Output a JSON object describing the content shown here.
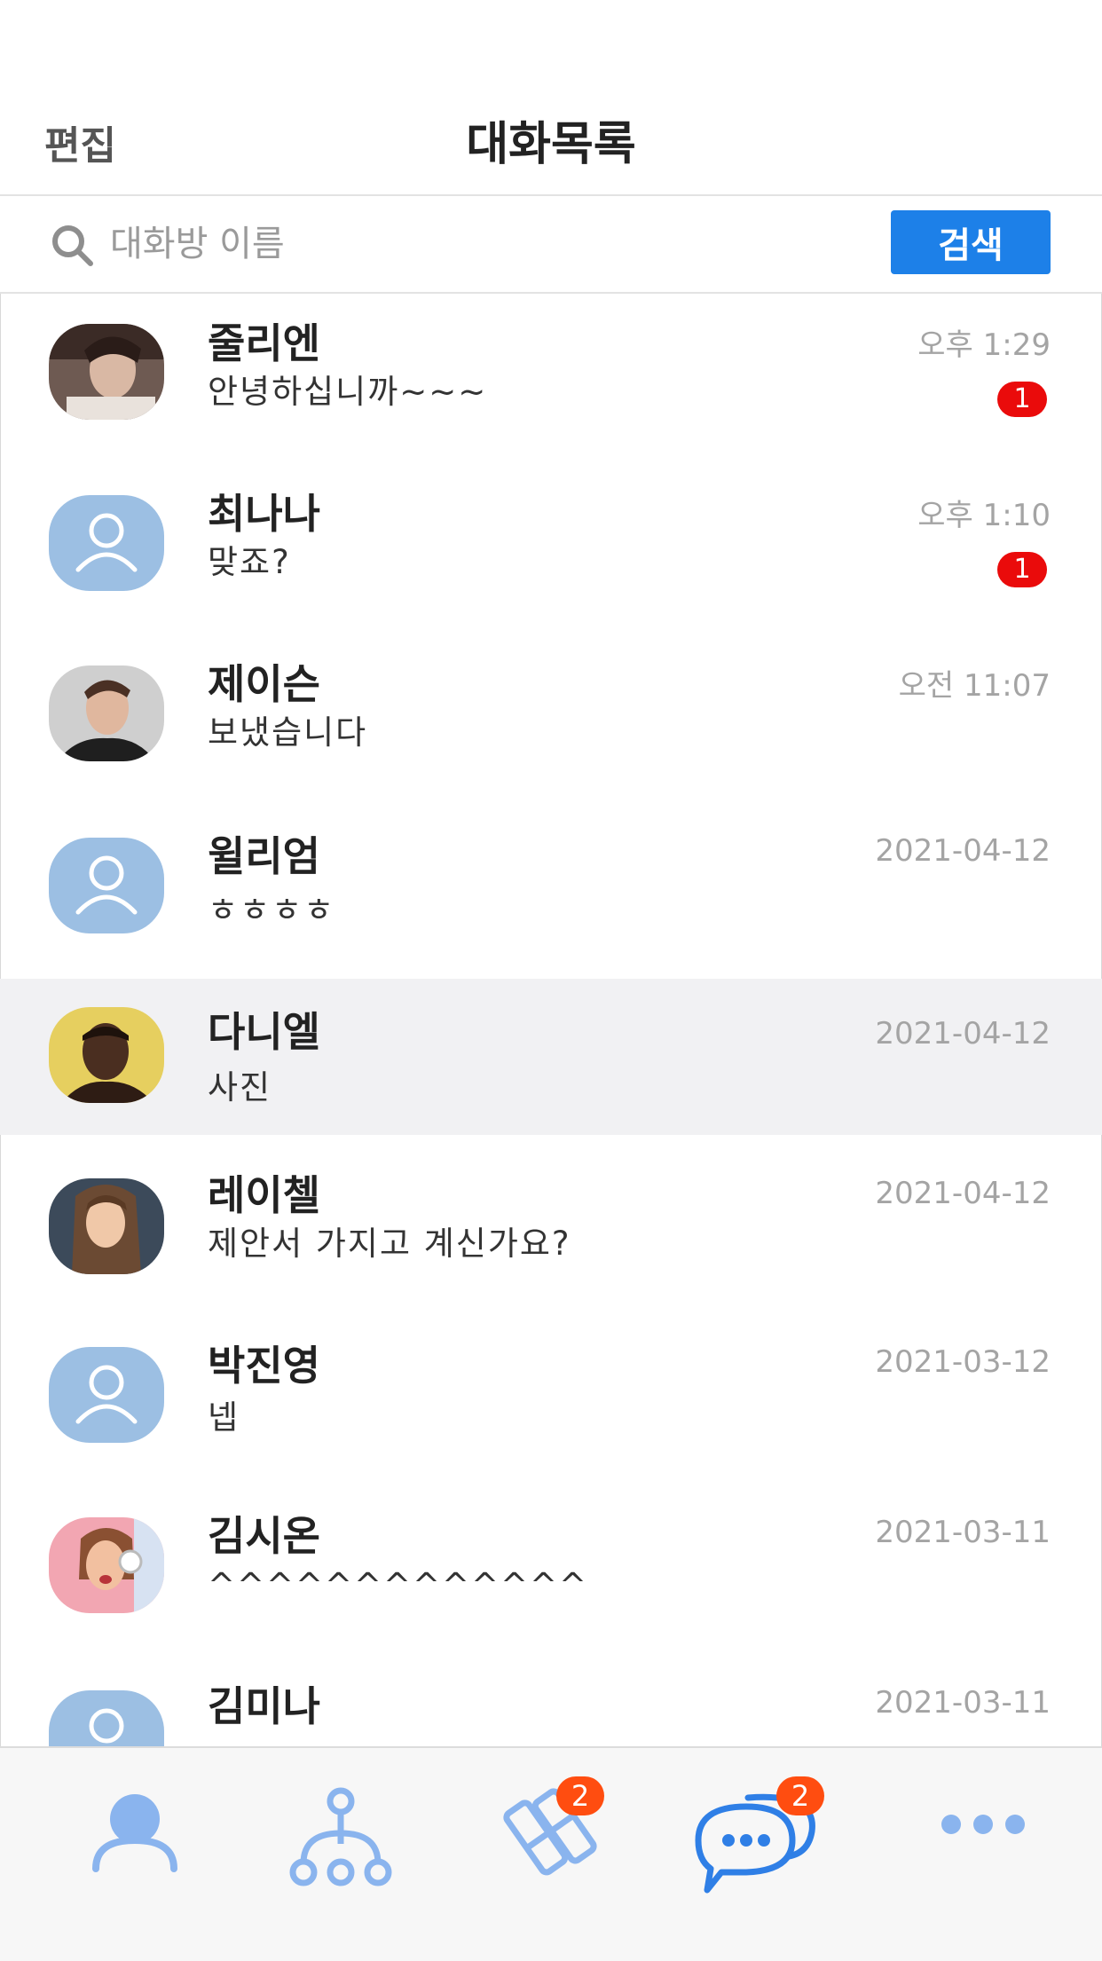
{
  "header": {
    "edit_label": "편집",
    "title": "대화목록"
  },
  "search": {
    "placeholder": "대화방 이름",
    "button_label": "검색"
  },
  "chats": [
    {
      "name": "줄리엔",
      "message": "안녕하십니까~~~",
      "time": "오후 1:29",
      "unread": "1",
      "avatar": "photo-man-hair",
      "selected": false
    },
    {
      "name": "최나나",
      "message": "맞죠?",
      "time": "오후 1:10",
      "unread": "1",
      "avatar": "default-person-icon",
      "selected": false
    },
    {
      "name": "제이슨",
      "message": "보냈습니다",
      "time": "오전 11:07",
      "unread": "",
      "avatar": "photo-man-black-shirt",
      "selected": false
    },
    {
      "name": "윌리엄",
      "message": "ㅎㅎㅎㅎ",
      "time": "2021-04-12",
      "unread": "",
      "avatar": "default-person-icon",
      "selected": false
    },
    {
      "name": "다니엘",
      "message": "사진",
      "time": "2021-04-12",
      "unread": "",
      "avatar": "photo-man-yellow-bg",
      "selected": true
    },
    {
      "name": "레이첼",
      "message": "제안서 가지고 계신가요?",
      "time": "2021-04-12",
      "unread": "",
      "avatar": "photo-woman-brown-hair",
      "selected": false
    },
    {
      "name": "박진영",
      "message": "넵",
      "time": "2021-03-12",
      "unread": "",
      "avatar": "default-person-icon",
      "selected": false
    },
    {
      "name": "김시온",
      "message": "^^^^^^^^^^^^^",
      "time": "2021-03-11",
      "unread": "",
      "avatar": "photo-woman-headphones",
      "selected": false
    },
    {
      "name": "김미나",
      "message": "",
      "time": "2021-03-11",
      "unread": "",
      "avatar": "default-person-icon",
      "selected": false
    }
  ],
  "tabbar": {
    "tabs": [
      {
        "icon": "person-icon",
        "badge": ""
      },
      {
        "icon": "org-chart-icon",
        "badge": ""
      },
      {
        "icon": "apps-icon",
        "badge": "2"
      },
      {
        "icon": "chat-bubbles-icon",
        "badge": "2"
      },
      {
        "icon": "more-dots-icon",
        "badge": ""
      }
    ]
  },
  "colors": {
    "accent": "#1d80e8",
    "badge_red": "#ea0b0b",
    "tab_badge": "#ff4d10",
    "avatar_default": "#9cbfe3",
    "tab_icon": "#8ab4ee",
    "tab_icon_active": "#2f7fe6",
    "selected_row": "#f1f1f3"
  }
}
